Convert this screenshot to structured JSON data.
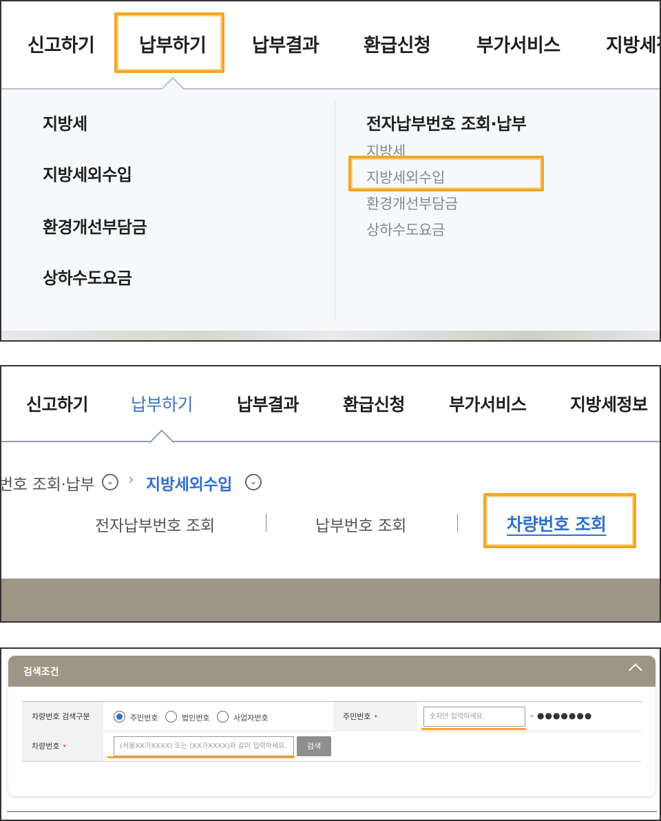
{
  "panel1": {
    "nav": [
      "신고하기",
      "납부하기",
      "납부결과",
      "환급신청",
      "부가서비스",
      "지방세정보"
    ],
    "menu_left": [
      "지방세",
      "지방세외수입",
      "환경개선부담금",
      "상하수도요금"
    ],
    "menu_right_title": "전자납부번호 조회·납부",
    "menu_right_items": [
      "지방세",
      "지방세외수입",
      "환경개선부담금",
      "상하수도요금"
    ]
  },
  "panel2": {
    "nav": [
      "신고하기",
      "납부하기",
      "납부결과",
      "환급신청",
      "부가서비스",
      "지방세정보"
    ],
    "breadcrumb_prev": "번호 조회·납부",
    "breadcrumb_current": "지방세외수입",
    "tabs": [
      "전자납부번호 조회",
      "납부번호 조회",
      "차량번호 조회"
    ]
  },
  "panel3": {
    "section_title": "검색조건",
    "row1_label": "차량번호 검색구분",
    "radio_options": [
      "주민번호",
      "법인번호",
      "사업자번호"
    ],
    "resident_label": "주민번호",
    "resident_placeholder": "숫자만 입력하세요.",
    "resident_dash": "-",
    "resident_masked": "●●●●●●●",
    "row2_label": "차량번호",
    "vehicle_placeholder": "(서울XX가XXXX) 또는 (XX가XXXX)와 같이 입력하세요.",
    "search_button": "검색",
    "required_mark": "•"
  },
  "colors": {
    "highlight": "#f5a623",
    "active_blue": "#2d6fd1",
    "bar_brown": "#9d9585"
  }
}
